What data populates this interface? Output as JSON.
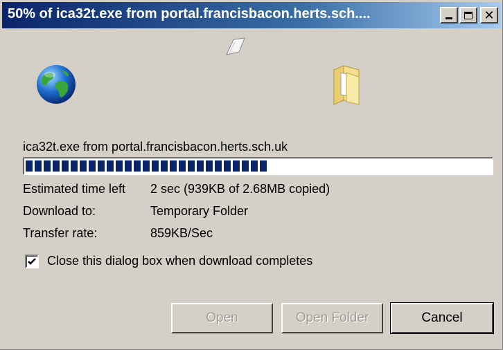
{
  "window": {
    "title": "50% of ica32t.exe from portal.francisbacon.herts.sch....",
    "controls": [
      "minimize-icon",
      "maximize-icon",
      "close-icon"
    ]
  },
  "download": {
    "source": "ica32t.exe from portal.francisbacon.herts.sch.uk",
    "progress_fraction": 0.52,
    "estimated_label": "Estimated time left",
    "estimated_value": "2 sec (939KB of 2.68MB copied)",
    "download_to_label": "Download to:",
    "download_to_value": "Temporary Folder",
    "rate_label": "Transfer rate:",
    "rate_value": "859KB/Sec"
  },
  "options": {
    "close_when_done_label": "Close this dialog box when download completes",
    "close_when_done_checked": true
  },
  "buttons": {
    "open": "Open",
    "open_folder": "Open Folder",
    "cancel": "Cancel"
  },
  "icons": {
    "source": "globe-icon",
    "flying": "paper-icon",
    "destination": "folder-icon"
  },
  "colors": {
    "progress": "#0a246a",
    "titlebar": "#0a246a"
  }
}
